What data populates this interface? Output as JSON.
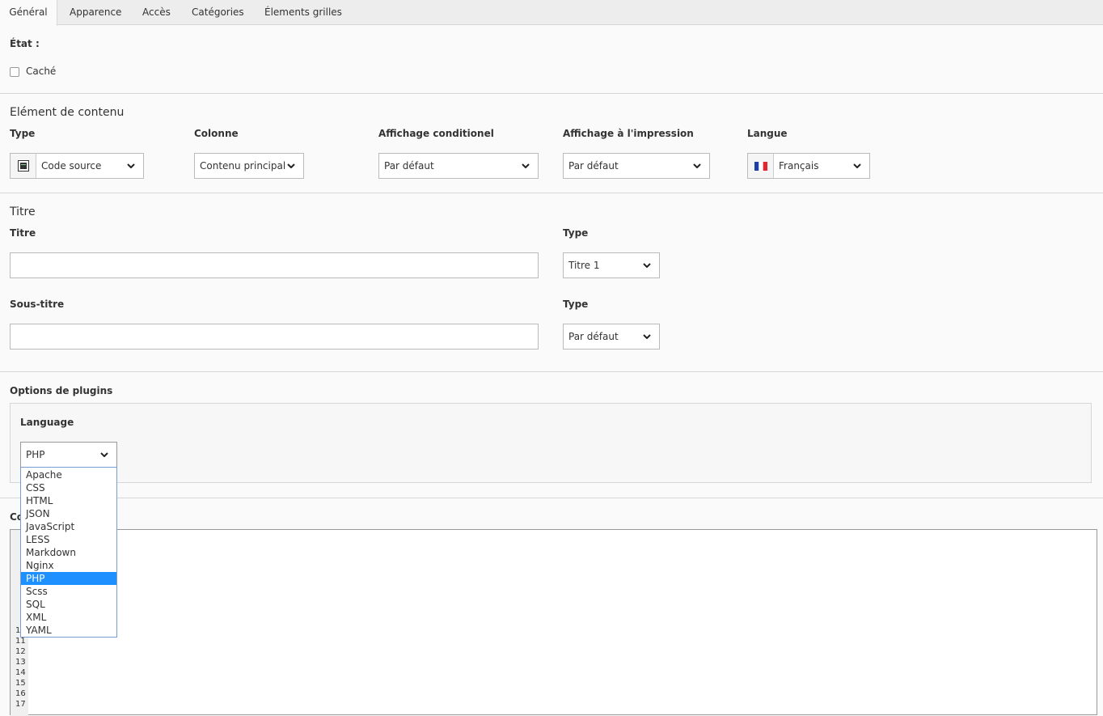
{
  "tabs": [
    "Général",
    "Apparence",
    "Accès",
    "Catégories",
    "Élements grilles"
  ],
  "etat": {
    "label": "État :",
    "hidden_label": "Caché"
  },
  "content_element": {
    "title": "Elément de contenu",
    "type": {
      "label": "Type",
      "value": "Code source"
    },
    "column": {
      "label": "Colonne",
      "value": "Contenu principal"
    },
    "conditional": {
      "label": "Affichage conditionel",
      "value": "Par défaut"
    },
    "print": {
      "label": "Affichage à l'impression",
      "value": "Par défaut"
    },
    "language": {
      "label": "Langue",
      "value": "Français"
    }
  },
  "titre_section": {
    "title": "Titre",
    "titre": {
      "label": "Titre",
      "value": ""
    },
    "titre_type": {
      "label": "Type",
      "value": "Titre 1"
    },
    "subtitle": {
      "label": "Sous-titre",
      "value": ""
    },
    "subtitle_type": {
      "label": "Type",
      "value": "Par défaut"
    }
  },
  "plugins": {
    "title": "Options de plugins",
    "language_label": "Language",
    "language_value": "PHP",
    "options": [
      "Apache",
      "CSS",
      "HTML",
      "JSON",
      "JavaScript",
      "LESS",
      "Markdown",
      "Nginx",
      "PHP",
      "Scss",
      "SQL",
      "XML",
      "YAML"
    ],
    "selected_index": 8
  },
  "code": {
    "label_partial": "Co",
    "line_partial": "1",
    "line_numbers": [
      "11",
      "12",
      "13",
      "14",
      "15",
      "16",
      "17"
    ]
  },
  "colors": {
    "selected": "#1e90ff",
    "border": "#d7d7d7",
    "dropdown_border": "#7a9cd3"
  }
}
